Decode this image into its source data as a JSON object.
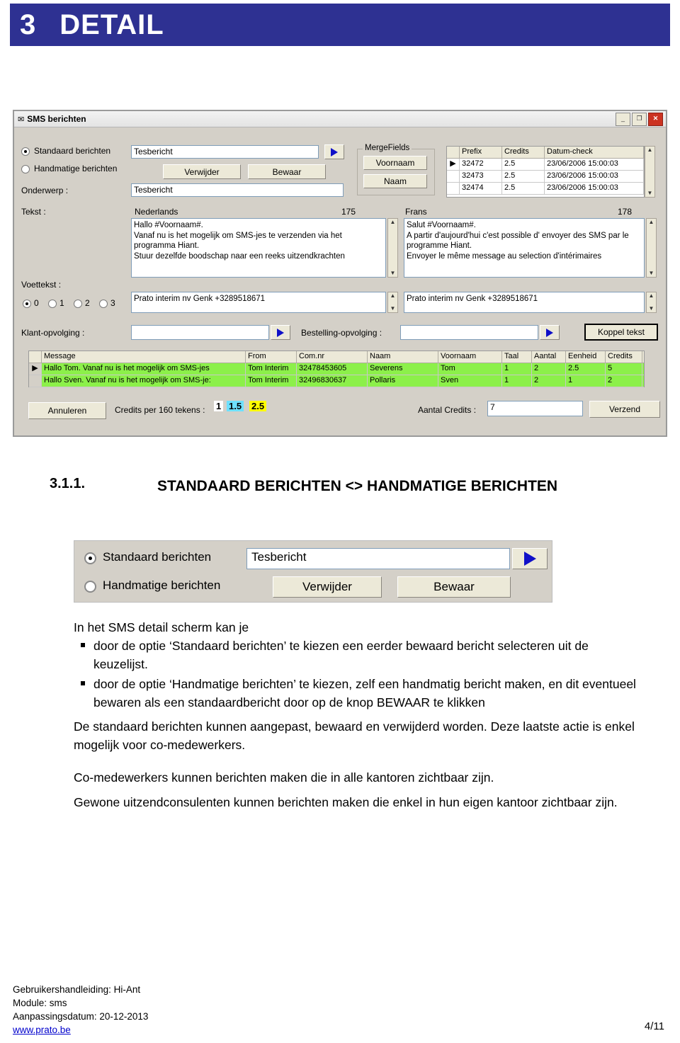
{
  "header": {
    "number": "3",
    "title": "DETAIL"
  },
  "sms_window": {
    "title": "SMS berichten",
    "title_icon": "envelope-icon",
    "window_buttons": {
      "minimize": "_",
      "maximize": "❐",
      "close": "✕"
    },
    "radios": {
      "standaard": "Standaard berichten",
      "handmatige": "Handmatige berichten"
    },
    "message_select_value": "Tesbericht",
    "buttons": {
      "verwijder": "Verwijder",
      "bewaar": "Bewaar",
      "koppel_tekst": "Koppel tekst",
      "annuleren": "Annuleren",
      "verzend": "Verzend"
    },
    "labels": {
      "onderwerp": "Onderwerp :",
      "tekst": "Tekst :",
      "voettekst": "Voettekst :",
      "klant_opvolging": "Klant-opvolging :",
      "bestelling_opvolging": "Bestelling-opvolging :",
      "credits_per_160": "Credits per 160 tekens :",
      "aantal_credits": "Aantal Credits :",
      "nederlands": "Nederlands",
      "frans": "Frans",
      "nl_count": "175",
      "fr_count": "178",
      "mergefields": "MergeFields"
    },
    "onderwerp_value": "Tesbericht",
    "mergefields": {
      "voornaam": "Voornaam",
      "naam": "Naam"
    },
    "nl_text": "Hallo #Voornaam#.\nVanaf nu is het mogelijk om SMS-jes te verzenden via het programma Hiant.\nStuur dezelfde boodschap naar een reeks uitzendkrachten",
    "fr_text": "Salut #Voornaam#.\nA partir d'aujourd'hui c'est possible d' envoyer des SMS par le programme Hiant.\nEnvoyer le même message au selection d'intérimaires",
    "nl_footer": "Prato interim nv Genk +3289518671",
    "fr_footer": "Prato interim nv Genk +3289518671",
    "voettekst_options": [
      "0",
      "1",
      "2",
      "3"
    ],
    "klant_opvolging_value": "",
    "bestelling_opvolging_value": "",
    "aantal_credits_value": "7",
    "credit_chips": [
      "1",
      "1.5",
      "2.5"
    ],
    "credits_grid": {
      "columns": [
        "Prefix",
        "Credits",
        "Datum-check"
      ],
      "rows": [
        [
          "32472",
          "2.5",
          "23/06/2006 15:00:03"
        ],
        [
          "32473",
          "2.5",
          "23/06/2006 15:00:03"
        ],
        [
          "32474",
          "2.5",
          "23/06/2006 15:00:03"
        ]
      ]
    },
    "message_grid": {
      "columns": [
        "Message",
        "From",
        "Com.nr",
        "Naam",
        "Voornaam",
        "Taal",
        "Aantal",
        "Eenheid",
        "Credits"
      ],
      "rows": [
        [
          "Hallo Tom. Vanaf nu is het mogelijk om SMS-jes",
          "Tom Interim",
          "32478453605",
          "Severens",
          "Tom",
          "1",
          "2",
          "2.5",
          "5"
        ],
        [
          "Hallo Sven. Vanaf nu is het mogelijk om SMS-je:",
          "Tom Interim",
          "32496830637",
          "Pollaris",
          "Sven",
          "1",
          "2",
          "1",
          "2"
        ]
      ]
    }
  },
  "section": {
    "number": "3.1.1.",
    "title": "STANDAARD BERICHTEN <> HANDMATIGE BERICHTEN"
  },
  "shot2": {
    "radio_standaard": "Standaard berichten",
    "radio_handmatige": "Handmatige berichten",
    "field_value": "Tesbericht",
    "btn_verwijder": "Verwijder",
    "btn_bewaar": "Bewaar"
  },
  "body": {
    "intro": "In het SMS detail scherm kan je",
    "bullet1": "door de optie ‘Standaard berichten’ te kiezen een eerder bewaard bericht selecteren uit de keuzelijst.",
    "bullet2": "door de optie ‘Handmatige berichten’ te kiezen, zelf een handmatig bericht maken, en dit eventueel bewaren als een standaardbericht door op de knop BEWAAR te klikken",
    "p2": "De standaard berichten kunnen aangepast, bewaard en verwijderd worden. Deze laatste actie is enkel mogelijk voor co-medewerkers.",
    "p3": "Co-medewerkers kunnen berichten maken die in alle kantoren zichtbaar zijn.",
    "p4": "Gewone uitzendconsulenten kunnen berichten maken die enkel in hun eigen kantoor zichtbaar zijn."
  },
  "footer": {
    "line1": "Gebruikershandleiding: Hi-Ant",
    "line2": "Module: sms",
    "line3": "Aanpassingsdatum: 20-12-2013",
    "url": "www.prato.be",
    "page": "4/11"
  }
}
